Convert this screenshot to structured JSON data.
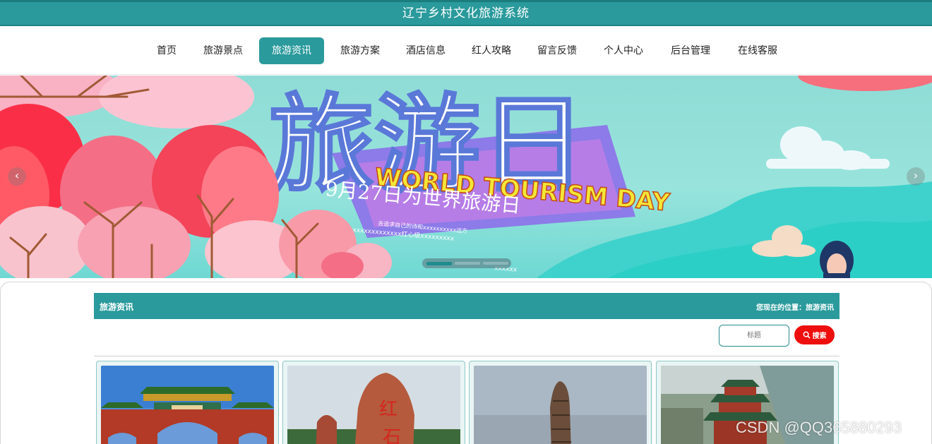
{
  "app": {
    "title": "辽宁乡村文化旅游系统"
  },
  "nav": {
    "items": [
      {
        "label": "首页",
        "active": false,
        "w": 0
      },
      {
        "label": "旅游景点",
        "active": false
      },
      {
        "label": "旅游资讯",
        "active": true
      },
      {
        "label": "旅游方案",
        "active": false
      },
      {
        "label": "酒店信息",
        "active": false
      },
      {
        "label": "红人攻略",
        "active": false
      },
      {
        "label": "留言反馈",
        "active": false
      },
      {
        "label": "个人中心",
        "active": false
      },
      {
        "label": "后台管理",
        "active": false
      },
      {
        "label": "在线客服",
        "active": false
      }
    ]
  },
  "banner": {
    "headline": "旅游日",
    "english": "WORLD TOURISM DAY",
    "date_line": "9月27日为世界旅游日",
    "small_line1": "去追求自己的诗和xxxxxxxxxx远方",
    "small_line2": "旅xxxxxxxxxxxxxx红心级xxxxxxxxx",
    "small_line3": "xxxxxx",
    "prev_icon": "chevron-left-icon",
    "next_icon": "chevron-right-icon",
    "slides": 3,
    "active_slide": 0
  },
  "section": {
    "title": "旅游资讯",
    "breadcrumb": "您现在的位置：旅游资讯"
  },
  "search": {
    "placeholder": "标题",
    "button_label": "搜索",
    "icon": "search-icon"
  },
  "cards": [
    {
      "name": "card-gate"
    },
    {
      "name": "card-red-rock"
    },
    {
      "name": "card-stone-pillar"
    },
    {
      "name": "card-pavilion"
    }
  ],
  "watermark": "CSDN @QQ365880293",
  "colors": {
    "accent": "#2a9a9c",
    "search": "#ee0e0e"
  }
}
